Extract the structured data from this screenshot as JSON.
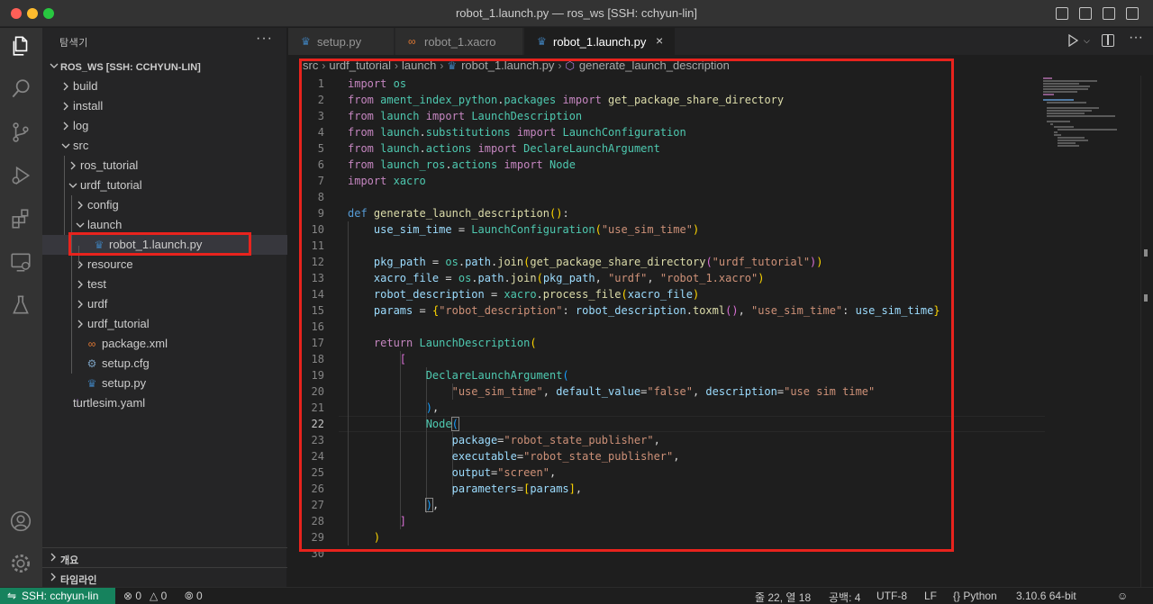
{
  "window": {
    "title": "robot_1.launch.py — ros_ws [SSH: cchyun-lin]"
  },
  "activity_bar": {
    "items": [
      "explorer-icon",
      "search-icon",
      "source-control-icon",
      "run-debug-icon",
      "extensions-icon",
      "remote-explorer-icon",
      "testing-icon"
    ],
    "bottom": [
      "accounts-icon",
      "settings-gear-icon"
    ]
  },
  "sidebar": {
    "title": "탐색기",
    "more": "···",
    "workspace": "ROS_WS [SSH: CCHYUN-LIN]",
    "tree": [
      {
        "label": "build",
        "type": "folder",
        "depth": 0,
        "expanded": false
      },
      {
        "label": "install",
        "type": "folder",
        "depth": 0,
        "expanded": false
      },
      {
        "label": "log",
        "type": "folder",
        "depth": 0,
        "expanded": false
      },
      {
        "label": "src",
        "type": "folder",
        "depth": 0,
        "expanded": true
      },
      {
        "label": "ros_tutorial",
        "type": "folder",
        "depth": 1,
        "expanded": false
      },
      {
        "label": "urdf_tutorial",
        "type": "folder",
        "depth": 1,
        "expanded": true
      },
      {
        "label": "config",
        "type": "folder",
        "depth": 2,
        "expanded": false
      },
      {
        "label": "launch",
        "type": "folder",
        "depth": 2,
        "expanded": true
      },
      {
        "label": "robot_1.launch.py",
        "type": "python",
        "depth": 3,
        "selected": true
      },
      {
        "label": "resource",
        "type": "folder",
        "depth": 2,
        "expanded": false
      },
      {
        "label": "test",
        "type": "folder",
        "depth": 2,
        "expanded": false
      },
      {
        "label": "urdf",
        "type": "folder",
        "depth": 2,
        "expanded": false
      },
      {
        "label": "urdf_tutorial",
        "type": "folder",
        "depth": 2,
        "expanded": false
      },
      {
        "label": "package.xml",
        "type": "xml",
        "depth": 2
      },
      {
        "label": "setup.cfg",
        "type": "cfg",
        "depth": 2
      },
      {
        "label": "setup.py",
        "type": "python",
        "depth": 2
      },
      {
        "label": "turtlesim.yaml",
        "type": "yaml",
        "depth": 0
      }
    ],
    "outline": "개요",
    "timeline": "타임라인"
  },
  "tabs": [
    {
      "label": "setup.py",
      "icon": "python-file-icon",
      "active": false
    },
    {
      "label": "robot_1.xacro",
      "icon": "xml-file-icon",
      "active": false
    },
    {
      "label": "robot_1.launch.py",
      "icon": "python-file-icon",
      "active": true,
      "close": "×"
    }
  ],
  "breadcrumb": [
    "src",
    "urdf_tutorial",
    "launch",
    "robot_1.launch.py",
    "generate_launch_description"
  ],
  "editor": {
    "current_line": 22,
    "line_numbers": [
      "1",
      "2",
      "3",
      "4",
      "5",
      "6",
      "7",
      "8",
      "9",
      "10",
      "11",
      "12",
      "13",
      "14",
      "15",
      "16",
      "17",
      "18",
      "19",
      "20",
      "21",
      "22",
      "23",
      "24",
      "25",
      "26",
      "27",
      "28",
      "29",
      "30"
    ]
  },
  "status_bar": {
    "remote": "SSH: cchyun-lin",
    "errors": "0",
    "warnings": "0",
    "ports": "0",
    "position": "줄 22, 열 18",
    "indent": "공백: 4",
    "encoding": "UTF-8",
    "eol": "LF",
    "language": "Python",
    "interpreter": "3.10.6 64-bit"
  }
}
